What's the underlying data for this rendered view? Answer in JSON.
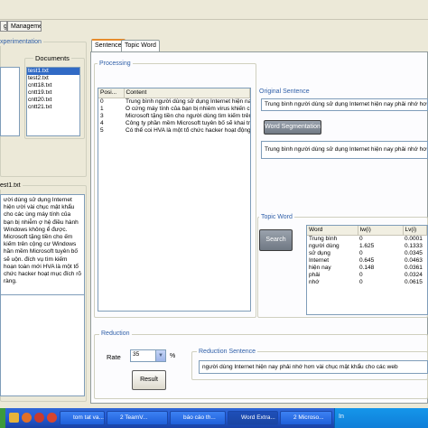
{
  "menubar": {
    "items": [
      "g",
      "Management"
    ]
  },
  "left_panel": {
    "group_title": "xperimentation",
    "documents_label": "Documents",
    "documents": [
      "test1.txt",
      "test2.txt",
      "cntt18.txt",
      "cntt19.txt",
      "cntt20.txt",
      "cntt21.txt"
    ],
    "selected_document": "test1.txt",
    "preview_title": "est1.txt",
    "preview_text": "ười dùng sử dụng Internet hiện ười vài chục mật khẩu cho các ùng máy tính của bạn bị nhiễm ợ hệ điều hành Windows không ể được. Microsoft tặng tiền cho ếm kiếm trên cộng cư Windows hần mềm Microsoft tuyên bố sẽ uộn. đích vụ tìm kiếm hoạn toàn mới HVA là một tổ chức hacker hoạt mục đích rõ ràng."
  },
  "tabs": [
    "Sentence",
    "Topic Word"
  ],
  "active_tab": "Sentence",
  "processing": {
    "group_title": "Processing",
    "columns": [
      "Posi...",
      "Content"
    ],
    "rows": [
      {
        "pos": "0",
        "content": "Trung bình người dùng sử dụng Internet hiện nay phải nhớ hơn"
      },
      {
        "pos": "1",
        "content": "Ổ cứng máy tính của bạn bị nhiễm virus khiến cho hệ điều hành"
      },
      {
        "pos": "3",
        "content": "Microsoft tặng tiền cho người dùng tìm kiếm trên cộng"
      },
      {
        "pos": "4",
        "content": "Công ty phần mềm Microsoft tuyên bố sẽ khai trương"
      },
      {
        "pos": "5",
        "content": "Có thể coi HVA là một tổ chức hacker hoạt động có"
      }
    ]
  },
  "original_sentence": {
    "label": "Original Sentence",
    "text": "Trung bình người dùng sử dụng Internet hiện nay phải nhớ hơn vài chục",
    "segment_button": "Word Segmentation",
    "segmented_text": "Trung bình người dùng sử dụng Internet hiện nay phải nhớ hơn vài"
  },
  "topic_word": {
    "label": "Topic Word",
    "search_button": "Search",
    "columns": [
      "Word",
      "Iw(i)",
      "Lv(i)"
    ],
    "rows": [
      {
        "word": "Trung bình",
        "iw": "0",
        "lv": "0.0001"
      },
      {
        "word": "người dùng",
        "iw": "1.625",
        "lv": "0.1333"
      },
      {
        "word": "sử dụng",
        "iw": "0",
        "lv": "0.0345"
      },
      {
        "word": "Internet",
        "iw": "0.645",
        "lv": "0.0463"
      },
      {
        "word": "hiện nay",
        "iw": "0.148",
        "lv": "0.0361"
      },
      {
        "word": "phải",
        "iw": "0",
        "lv": "0.0324"
      },
      {
        "word": "nhớ",
        "iw": "0",
        "lv": "0.0615"
      }
    ]
  },
  "reduction": {
    "group_title": "Reduction",
    "rate_label": "Rate",
    "rate_value": "35",
    "rate_unit": "%",
    "result_button": "Result",
    "sentence_title": "Reduction Sentence",
    "sentence_text": "người dùng Internet hiện nay phải nhớ hơn vài chục mật khẩu cho các web"
  },
  "taskbar": {
    "buttons": [
      "tom tat va...",
      "2 TeamV...",
      "báo cáo th...",
      "Word Extra...",
      "2 Microso..."
    ],
    "active_index": 3,
    "tray_text": "In"
  }
}
